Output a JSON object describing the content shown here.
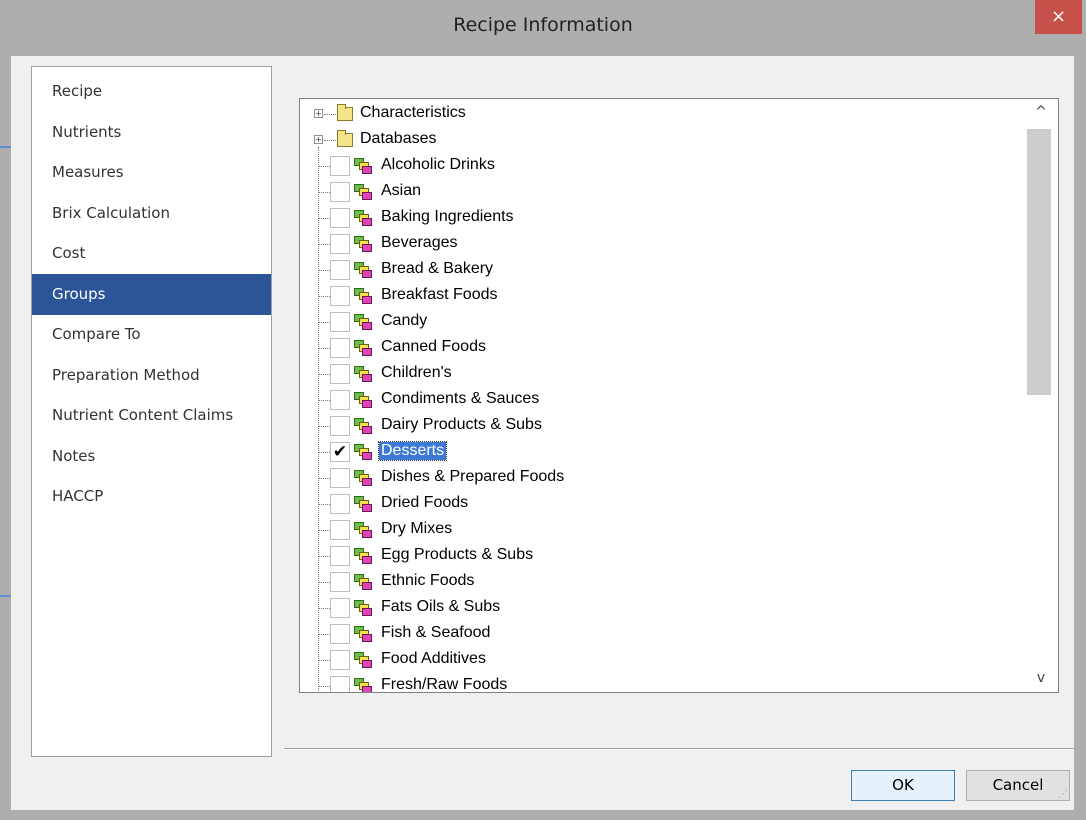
{
  "window": {
    "title": "Recipe Information",
    "close_label": "×"
  },
  "nav": {
    "items": [
      {
        "label": "Recipe"
      },
      {
        "label": "Nutrients"
      },
      {
        "label": "Measures"
      },
      {
        "label": "Brix Calculation"
      },
      {
        "label": "Cost"
      },
      {
        "label": "Groups",
        "selected": true
      },
      {
        "label": "Compare To"
      },
      {
        "label": "Preparation Method"
      },
      {
        "label": "Nutrient Content Claims"
      },
      {
        "label": "Notes"
      },
      {
        "label": "HACCP"
      }
    ]
  },
  "tree": {
    "folders": [
      {
        "label": "Characteristics",
        "expander": "+"
      },
      {
        "label": "Databases",
        "expander": "+"
      }
    ],
    "groups": [
      {
        "label": "Alcoholic Drinks",
        "checked": false
      },
      {
        "label": "Asian",
        "checked": false
      },
      {
        "label": "Baking Ingredients",
        "checked": false
      },
      {
        "label": "Beverages",
        "checked": false
      },
      {
        "label": "Bread & Bakery",
        "checked": false
      },
      {
        "label": "Breakfast Foods",
        "checked": false
      },
      {
        "label": "Candy",
        "checked": false
      },
      {
        "label": "Canned Foods",
        "checked": false
      },
      {
        "label": "Children's",
        "checked": false
      },
      {
        "label": "Condiments & Sauces",
        "checked": false
      },
      {
        "label": "Dairy Products & Subs",
        "checked": false
      },
      {
        "label": "Desserts",
        "checked": true,
        "selected": true
      },
      {
        "label": "Dishes & Prepared Foods",
        "checked": false
      },
      {
        "label": "Dried Foods",
        "checked": false
      },
      {
        "label": "Dry Mixes",
        "checked": false
      },
      {
        "label": "Egg Products & Subs",
        "checked": false
      },
      {
        "label": "Ethnic Foods",
        "checked": false
      },
      {
        "label": "Fats Oils & Subs",
        "checked": false
      },
      {
        "label": "Fish & Seafood",
        "checked": false
      },
      {
        "label": "Food Additives",
        "checked": false
      },
      {
        "label": "Fresh/Raw Foods",
        "checked": false
      }
    ],
    "check_mark": "✔",
    "scroll_up": "^",
    "scroll_down": "v"
  },
  "buttons": {
    "ok": "OK",
    "cancel": "Cancel"
  },
  "colors": {
    "selection": "#2c5599",
    "close": "#c7504a"
  }
}
